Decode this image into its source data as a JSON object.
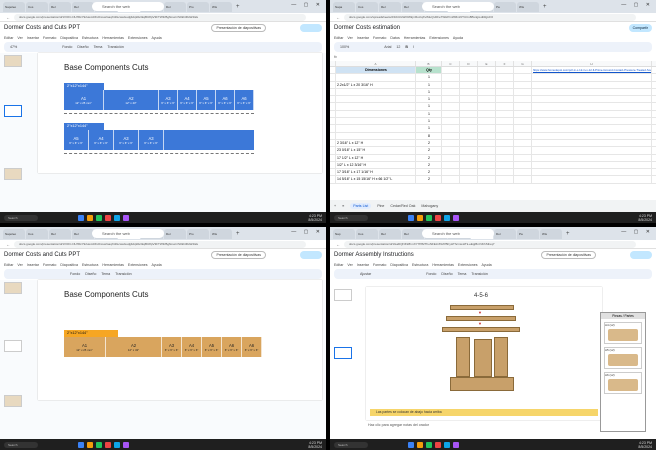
{
  "taskbar": {
    "search_placeholder": "Search",
    "time": "4:23 PM",
    "date": "8/5/2024"
  },
  "q1": {
    "browser": {
      "tabs": [
        "Napoleo",
        "Cos",
        "Rel",
        "Rel",
        "Re",
        "Dor",
        "Dor",
        "Dor",
        "Pro",
        "Wis"
      ],
      "search_label": "Search the web",
      "url": "docs.google.com/presentation/d/1VIOC-NUh5sY92uwmDhdCxuwGaqfn3GcwaGuqlj4dqWe3kqBU8pV3FTW3rBg6mwnrS0kI4RoW4t2e"
    },
    "doc_title": "Dormer Costs and Cuts PPT",
    "menu": [
      "Editar",
      "Ver",
      "Insertar",
      "Formato",
      "Diapositiva",
      "Estructura",
      "Herramientas",
      "Extensiones",
      "Ayuda"
    ],
    "present_label": "Presentación de diapositivas",
    "toolbar": [
      "Fondo",
      "Diseño",
      "Tema",
      "Transición"
    ],
    "zoom": "47%",
    "slide_title": "Base Components Cuts",
    "board1": {
      "label": "2\"x12\"x144\"",
      "cells": [
        {
          "name": "A1",
          "dim": "12\" x 25 mm\""
        },
        {
          "name": "A2",
          "dim": "12\" x 43\""
        },
        {
          "name": "A3",
          "dim": "6\" x 6\" x 6\""
        },
        {
          "name": "A4",
          "dim": "6\" x 6\" x 6\""
        },
        {
          "name": "A5",
          "dim": "6\" x 6\" x 6\""
        },
        {
          "name": "A6",
          "dim": "6\" x 6\" x 6\""
        },
        {
          "name": "A6",
          "dim": "6\" x 6\" x 6\""
        }
      ]
    },
    "board2": {
      "label": "2\"x12\"x144\"",
      "cells": [
        {
          "name": "A5",
          "dim": "6\" x 6\" x 6\""
        },
        {
          "name": "A4",
          "dim": "6\" x 6\" x 6\""
        },
        {
          "name": "A3",
          "dim": "6\" x 6\" x 6\""
        },
        {
          "name": "A3",
          "dim": "6\" x 6\" x 6\""
        }
      ]
    },
    "color": "#3c78d8"
  },
  "q2": {
    "browser": {
      "tabs": [
        "Napa",
        "Cos",
        "Rel",
        "Rel",
        "Ba",
        "Dor",
        "Dor",
        "Pa",
        "Wis"
      ],
      "search_label": "Search the web",
      "url": "docs.google.com/spreadsheets/d/1IbUIsWr0Wkjm5uUqXvIMuQvDFe7WHPmWMmhfTUCv8Bx4g/edit#gid=0"
    },
    "doc_title": "Dormer Costs estimation",
    "menu": [
      "Editar",
      "Ver",
      "Insertar",
      "Formato",
      "Datos",
      "Herramientas",
      "Extensiones",
      "Ayuda"
    ],
    "share_label": "Compartir",
    "zoom": "100%",
    "font": "Arial",
    "font_size": "12",
    "columns": [
      "",
      "A",
      "B",
      "C",
      "D",
      "E",
      "F",
      "G",
      "H"
    ],
    "header": {
      "dimensions": "Dimensiones",
      "qty": "Qty"
    },
    "rows": [
      {
        "dim": "",
        "qty": "1"
      },
      {
        "dim": "2.2x1/2\" L x 20 3/16\" H",
        "qty": "1"
      },
      {
        "dim": "",
        "qty": "1"
      },
      {
        "dim": "",
        "qty": "1"
      },
      {
        "dim": "",
        "qty": "1"
      },
      {
        "dim": "",
        "qty": "1"
      },
      {
        "dim": "",
        "qty": "1"
      },
      {
        "dim": "",
        "qty": "1"
      },
      {
        "dim": "",
        "qty": "8"
      },
      {
        "dim": "2 3/16\" L x 12\" H",
        "qty": "2"
      },
      {
        "dim": "23 0/16\" L x 15\" H",
        "qty": "2"
      },
      {
        "dim": "17 1/2\" L x 12\" H",
        "qty": "2"
      },
      {
        "dim": "1/2\" L x 12 3/16\" H",
        "qty": "2"
      },
      {
        "dim": "17 3/16\" L x 17 1/16\" H",
        "qty": "2"
      },
      {
        "dim": "14 5/16\" L x 15 15/16\" H x 66 1/2\" L",
        "qty": "2"
      }
    ],
    "link": "https://www.homedepot.com/p/2-in-x-12-in-x-12-ft-Prime-Ground-Contact-Pressure-Treated-Southern-Yellow-Pine-Lumber",
    "sheet_tabs": [
      "Parts List",
      "Pine",
      "Cedar/Red Oak",
      "Mahogany"
    ],
    "accent": "#0f9d58"
  },
  "q3": {
    "browser": {
      "tabs": [
        "Napoleo",
        "Cos",
        "Rel",
        "Rel",
        "Re",
        "Dor",
        "Dor",
        "Dor",
        "Pro",
        "Wis"
      ],
      "search_label": "Search the web",
      "url": "docs.google.com/presentation/d/1VIOC-NUh5sY92uwmDhdCxuwGaqfn3GcwaGuqlj4dqWe3kqBU8pV3FTW3rBg6mwnrS0kI4RoW4t2e"
    },
    "doc_title": "Dormer Costs and Cuts PPT",
    "menu": [
      "Editar",
      "Ver",
      "Insertar",
      "Formato",
      "Diapositiva",
      "Estructura",
      "Herramientas",
      "Extensiones",
      "Ayuda"
    ],
    "present_label": "Presentación de diapositivas",
    "toolbar": [
      "Fondo",
      "Diseño",
      "Tema",
      "Transición"
    ],
    "slide_title": "Base Components Cuts",
    "board": {
      "label": "2\"x12\"x144\"",
      "cells": [
        {
          "name": "A1",
          "dim": "12\" x 25 mm\""
        },
        {
          "name": "A2",
          "dim": "12\" x 43\""
        },
        {
          "name": "A3",
          "dim": "6\" x 6\" x 6\""
        },
        {
          "name": "A4",
          "dim": "6\" x 6\" x 6\""
        },
        {
          "name": "A5",
          "dim": "6\" x 6\" x 6\""
        },
        {
          "name": "A6",
          "dim": "6\" x 6\" x 6\""
        },
        {
          "name": "A6",
          "dim": "6\" x 6\" x 6\""
        }
      ]
    },
    "color": "#d9a55e",
    "label_color": "#f6a623"
  },
  "q4": {
    "browser": {
      "tabs": [
        "Nap",
        "Cos",
        "Rel",
        "Rel",
        "Ba",
        "Dor",
        "Dor",
        "Dor",
        "Pa",
        "Wis"
      ],
      "search_label": "Search the web",
      "url": "docs.google.com/presentation/d/1GaDQNKWhmXY7P82ThoNFEzrZ9dYBFyHThcmwHTk-eEpjBnVJbhSfreq7"
    },
    "doc_title": "Dormer Assembly Instructions",
    "menu": [
      "Editar",
      "Ver",
      "Insertar",
      "Formato",
      "Diapositiva",
      "Estructura",
      "Herramientas",
      "Extensiones",
      "Ayuda"
    ],
    "present_label": "Presentación de diapositivas",
    "toolbar": [
      "Ajustar",
      "Fondo",
      "Diseño",
      "Tema",
      "Transición"
    ],
    "step_label": "4-5-6",
    "panel_title": "Piezas / Partes",
    "panel_items": [
      "A4 (x2)",
      "A5 (x2)",
      "A6 (x2)"
    ],
    "notes_placeholder": "Haz clic para agregar notas del orador",
    "caption": "Las partes se colocan de abajo hacia arriba"
  }
}
